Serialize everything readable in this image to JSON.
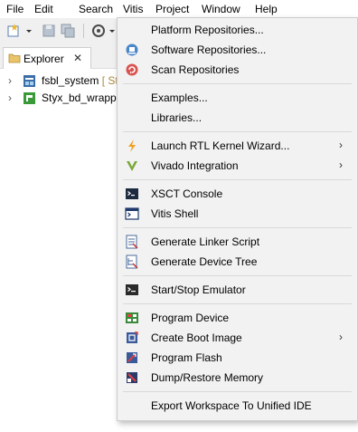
{
  "menubar": {
    "items": [
      {
        "label": "File"
      },
      {
        "label": "Edit"
      },
      {
        "label": "Search"
      },
      {
        "label": "Vitis"
      },
      {
        "label": "Project"
      },
      {
        "label": "Window"
      },
      {
        "label": "Help"
      }
    ]
  },
  "explorer": {
    "tab_label": "Explorer",
    "close_glyph": "✕",
    "rows": [
      {
        "arrow": "›",
        "label": "fsbl_system",
        "suffix": " [ Sty",
        "icon": "system-project-icon"
      },
      {
        "arrow": "›",
        "label": "Styx_bd_wrappe",
        "suffix": "",
        "icon": "platform-project-icon"
      }
    ]
  },
  "vitis_menu": {
    "items": [
      {
        "label": "Platform Repositories...",
        "icon": "platform-repo-icon",
        "submenu": false
      },
      {
        "label": "Software Repositories...",
        "icon": "software-repo-icon",
        "submenu": false
      },
      {
        "label": "Scan Repositories",
        "icon": "scan-repo-icon",
        "submenu": false
      },
      {
        "label": "Examples...",
        "icon": "",
        "submenu": false
      },
      {
        "label": "Libraries...",
        "icon": "",
        "submenu": false
      },
      {
        "label": "Launch RTL Kernel Wizard...",
        "icon": "lightning-icon",
        "submenu": true
      },
      {
        "label": "Vivado Integration",
        "icon": "vivado-icon",
        "submenu": true
      },
      {
        "label": "XSCT Console",
        "icon": "console-icon",
        "submenu": false
      },
      {
        "label": "Vitis Shell",
        "icon": "shell-icon",
        "submenu": false
      },
      {
        "label": "Generate Linker Script",
        "icon": "linker-script-icon",
        "submenu": false
      },
      {
        "label": "Generate Device Tree",
        "icon": "device-tree-icon",
        "submenu": false
      },
      {
        "label": "Start/Stop Emulator",
        "icon": "emulator-icon",
        "submenu": false
      },
      {
        "label": "Program Device",
        "icon": "program-device-icon",
        "submenu": false
      },
      {
        "label": "Create Boot Image",
        "icon": "boot-image-icon",
        "submenu": true
      },
      {
        "label": "Program Flash",
        "icon": "program-flash-icon",
        "submenu": false
      },
      {
        "label": "Dump/Restore Memory",
        "icon": "memory-icon",
        "submenu": false
      },
      {
        "label": "Export Workspace To Unified IDE",
        "icon": "",
        "submenu": false
      }
    ],
    "submenu_glyph": "›"
  },
  "colors": {
    "menu_bg": "#f2f2f2",
    "toolbar_bg": "#f0f0f0",
    "suffix": "#a8893b"
  }
}
